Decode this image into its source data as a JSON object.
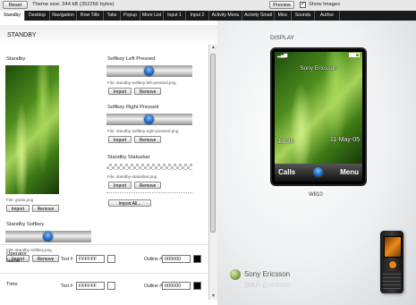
{
  "toolbar": {
    "reset_label": "Reset",
    "theme_size": "Theme size: 344 kB (352256 bytes)",
    "preview_label": "Preview",
    "show_images_label": "Show Images",
    "show_images_checked": true
  },
  "tabs": [
    "Standby",
    "Desktop",
    "Navigation",
    "Row Title",
    "Tabs",
    "Popup",
    "More List",
    "Input 1",
    "Input 2",
    "Activity Menu",
    "Activity Small",
    "Misc",
    "Sounds",
    "Author"
  ],
  "active_tab": "Standby",
  "left": {
    "section_title": "STANDBY",
    "standby": {
      "label": "Standby",
      "file": "File: grass.png",
      "import": "Import",
      "remove": "Remove"
    },
    "softkey": {
      "label": "Standby Softkey",
      "file": "File: standby-softkey.png",
      "import": "Import",
      "remove": "Remove"
    },
    "softkey_left": {
      "label": "Softkey Left Pressed",
      "file": "File: standby-softkey-left-pressed.png",
      "import": "Import",
      "remove": "Remove"
    },
    "softkey_right": {
      "label": "Softkey Right Pressed",
      "file": "File: standby-softkey-right-pressed.png",
      "import": "Import",
      "remove": "Remove"
    },
    "statusbar": {
      "label": "Standby Statusbar",
      "file": "File: standby-statusbar.png",
      "import": "Import",
      "remove": "Remove"
    },
    "import_all": "Import All...",
    "operator": {
      "label": "Operator Name",
      "text_label": "Text #",
      "text_value": "FFFFFF",
      "outline_label": "Outline #",
      "outline_value": "000000",
      "text_color": "#FFFFFF",
      "outline_color": "#000000"
    },
    "time": {
      "label": "Time",
      "text_label": "Text #",
      "text_value": "FFFFFF",
      "outline_label": "Outline #",
      "outline_value": "000000",
      "text_color": "#FFFFFF",
      "outline_color": "#000000"
    }
  },
  "right": {
    "section_title": "DISPLAY",
    "phone": {
      "operator": "Sony Ericsson",
      "time": "13:36",
      "date": "11-May-05",
      "left_softkey": "Calls",
      "right_softkey": "Menu"
    },
    "model": "W810",
    "brand": "Sony Ericsson"
  }
}
